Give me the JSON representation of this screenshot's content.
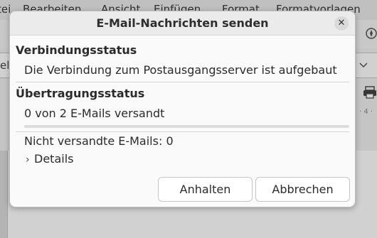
{
  "background": {
    "menu_items": [
      "tei",
      "Bearbeiten",
      "Ansicht",
      "Einfügen",
      "Format",
      "Formatvorlagen"
    ],
    "combo_left_text": "el"
  },
  "dialog": {
    "title": "E-Mail-Nachrichten senden",
    "connection_heading": "Verbindungsstatus",
    "connection_text": "Die Verbindung zum Postausgangsserver ist aufgebaut",
    "transfer_heading": "Übertragungsstatus",
    "transfer_text": "0 von 2 E-Mails versandt",
    "progress_fraction": 0,
    "unsent_text": "Nicht versandte E-Mails: 0",
    "details_label": "Details",
    "pause_button": "Anhalten",
    "cancel_button": "Abbrechen"
  },
  "colors": {
    "accent": "#e95420"
  }
}
